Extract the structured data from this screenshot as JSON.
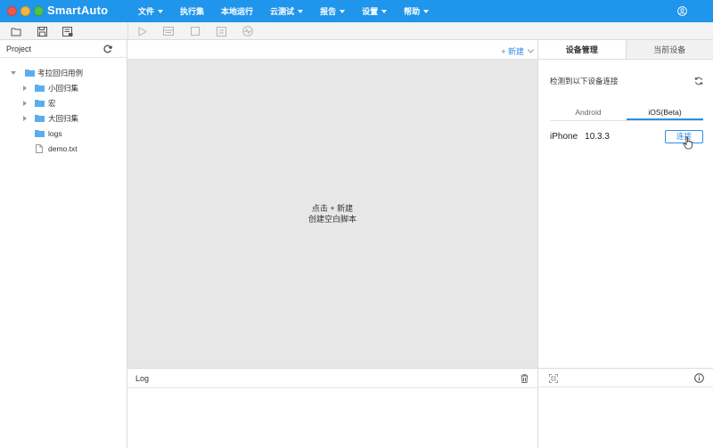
{
  "window": {
    "title": "SmartAuto"
  },
  "menu": [
    {
      "label": "文件",
      "has_dropdown": true
    },
    {
      "label": "执行集",
      "has_dropdown": false
    },
    {
      "label": "本地运行",
      "has_dropdown": false
    },
    {
      "label": "云测试",
      "has_dropdown": true
    },
    {
      "label": "报告",
      "has_dropdown": true
    },
    {
      "label": "设置",
      "has_dropdown": true
    },
    {
      "label": "帮助",
      "has_dropdown": true
    }
  ],
  "toolbar": {
    "icons": [
      "open-folder-icon",
      "save-icon",
      "save-as-icon",
      "play-icon",
      "record-icon",
      "stop-icon",
      "script-icon",
      "performance-icon"
    ]
  },
  "project": {
    "title": "Project",
    "tree": [
      {
        "label": "考拉回归用例",
        "type": "folder",
        "level": 0,
        "expanded": true
      },
      {
        "label": "小回归集",
        "type": "folder",
        "level": 1,
        "expanded": false
      },
      {
        "label": "宏",
        "type": "folder",
        "level": 1,
        "expanded": false
      },
      {
        "label": "大回归集",
        "type": "folder",
        "level": 1,
        "expanded": false
      },
      {
        "label": "logs",
        "type": "folder",
        "level": 1,
        "expanded": null
      },
      {
        "label": "demo.txt",
        "type": "file",
        "level": 1,
        "expanded": null
      }
    ]
  },
  "editor": {
    "new_label": "+ 新建",
    "hint_line1": "点击 + 新建",
    "hint_line2": "创建空白脚本"
  },
  "log": {
    "title": "Log"
  },
  "device": {
    "tabs": [
      {
        "label": "设备管理",
        "active": true
      },
      {
        "label": "当前设备",
        "active": false
      }
    ],
    "detect_text": "检测到以下设备连接",
    "os_tabs": [
      {
        "label": "Android",
        "active": false
      },
      {
        "label": "iOS(Beta)",
        "active": true
      }
    ],
    "devices": [
      {
        "name": "iPhone",
        "version": "10.3.3",
        "action": "连接"
      }
    ]
  },
  "colors": {
    "titlebar": "#1f95ec",
    "accent": "#2d8ee8",
    "folder": "#5aaef0",
    "editor_bg": "#e8e7e8"
  }
}
